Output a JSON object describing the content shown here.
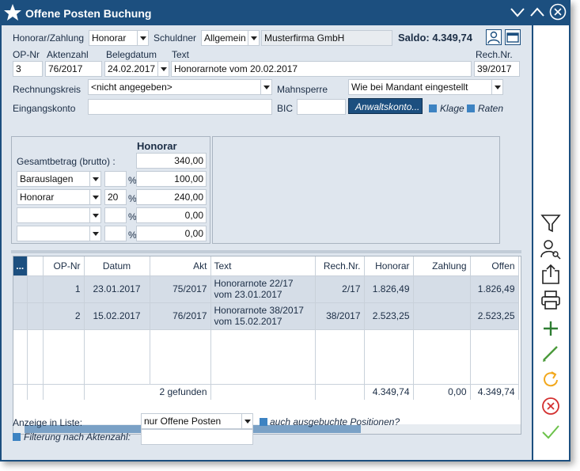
{
  "window": {
    "title": "Offene Posten Buchung"
  },
  "header": {
    "honorar_zahlung_label": "Honorar/Zahlung",
    "honorar_zahlung_value": "Honorar",
    "schuldner_label": "Schuldner",
    "schuldner_value": "Allgemein",
    "schuldner_name": "Musterfirma GmbH",
    "saldo": "Saldo: 4.349,74",
    "op_nr_label": "OP-Nr",
    "op_nr_value": "3",
    "aktenzahl_label": "Aktenzahl",
    "aktenzahl_value": "76/2017",
    "belegdatum_label": "Belegdatum",
    "belegdatum_value": "24.02.2017",
    "text_label": "Text",
    "text_value": "Honorarnote vom 20.02.2017",
    "rechnr_label": "Rech.Nr.",
    "rechnr_value": "39/2017",
    "rechnungskreis_label": "Rechnungskreis",
    "rechnungskreis_value": "<nicht angegeben>",
    "mahnsperre_label": "Mahnsperre",
    "mahnsperre_value": "Wie bei Mandant eingestellt",
    "eingangskonto_label": "Eingangskonto",
    "eingangskonto_value": "",
    "bic_label": "BIC",
    "bic_value": "",
    "anwaltskonto_button": "Anwaltskonto...",
    "klage_label": "Klage",
    "raten_label": "Raten"
  },
  "amounts": {
    "column_header": "Honorar",
    "gesamt_label": "Gesamtbetrag (brutto) :",
    "gesamt_value": "340,00",
    "rows": [
      {
        "type": "Barauslagen",
        "pct": "",
        "pct_sign": "%",
        "value": "100,00"
      },
      {
        "type": "Honorar",
        "pct": "20",
        "pct_sign": "%",
        "value": "240,00"
      },
      {
        "type": "",
        "pct": "",
        "pct_sign": "%",
        "value": "0,00"
      },
      {
        "type": "",
        "pct": "",
        "pct_sign": "%",
        "value": "0,00"
      }
    ]
  },
  "grid": {
    "menu_button": "...",
    "columns": [
      "OP-Nr",
      "Datum",
      "Akt",
      "Text",
      "Rech.Nr.",
      "Honorar",
      "Zahlung",
      "Offen"
    ],
    "rows": [
      {
        "op_nr": "1",
        "datum": "23.01.2017",
        "akt": "75/2017",
        "text1": "Honorarnote 22/17",
        "text2": "vom 23.01.2017",
        "rechnr": "2/17",
        "honorar": "1.826,49",
        "zahlung": "",
        "offen": "1.826,49"
      },
      {
        "op_nr": "2",
        "datum": "15.02.2017",
        "akt": "76/2017",
        "text1": "Honorarnote 38/2017",
        "text2": "vom 15.02.2017",
        "rechnr": "38/2017",
        "honorar": "2.523,25",
        "zahlung": "",
        "offen": "2.523,25"
      }
    ],
    "footer": {
      "count": "2 gefunden",
      "honorar": "4.349,74",
      "zahlung": "0,00",
      "offen": "4.349,74"
    }
  },
  "bottom": {
    "anzeige_label": "Anzeige in Liste:",
    "anzeige_value": "nur Offene Posten",
    "ausgebuchte_label": "auch ausgebuchte Positionen?",
    "filter_label": "Filterung nach Aktenzahl:",
    "filter_value": ""
  },
  "colors": {
    "titlebar": "#1c4f7f",
    "client": "#dfe6ee",
    "selected_row": "#d5dde7",
    "checkbox": "#3d83c2",
    "add_icon": "#2e7d32",
    "refresh_icon": "#f2a81d",
    "delete_icon": "#d32f2f",
    "confirm_icon": "#6cc24a"
  },
  "icons": [
    "star-icon",
    "minimize-icon",
    "maximize-icon",
    "close-icon",
    "person-icon",
    "card-icon",
    "filter-icon",
    "user-search-icon",
    "share-icon",
    "print-icon",
    "add-icon",
    "edit-icon",
    "refresh-icon",
    "delete-icon",
    "confirm-icon"
  ]
}
